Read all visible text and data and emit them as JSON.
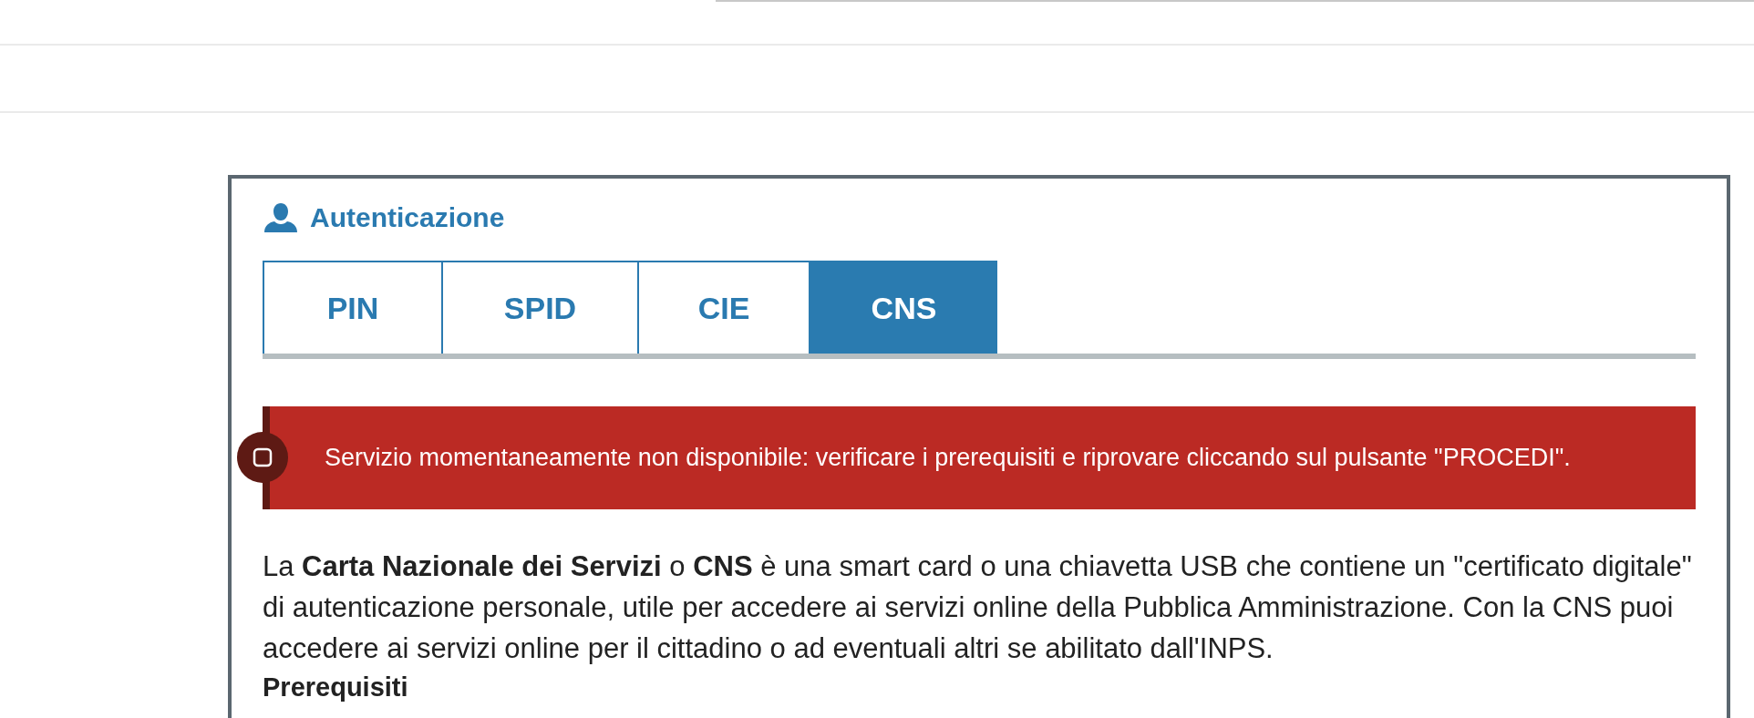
{
  "header": {
    "title": "Autenticazione"
  },
  "tabs": [
    {
      "label": "PIN",
      "selected": false
    },
    {
      "label": "SPID",
      "selected": false
    },
    {
      "label": "CIE",
      "selected": false
    },
    {
      "label": "CNS",
      "selected": true
    }
  ],
  "alert": {
    "message": "Servizio momentaneamente non disponibile: verificare i prerequisiti e riprovare cliccando sul pulsante \"PROCEDI\"."
  },
  "description": "La **Carta Nazionale dei Servizi** o **CNS** è una smart card o una chiavetta USB che contiene un \"certificato digitale\" di autenticazione personale, utile per accedere ai servizi online della Pubblica Amministrazione. Con la CNS puoi accedere ai servizi online per il cittadino o ad eventuali altri se abilitato dall'INPS.",
  "section_heading": "Prerequisiti"
}
